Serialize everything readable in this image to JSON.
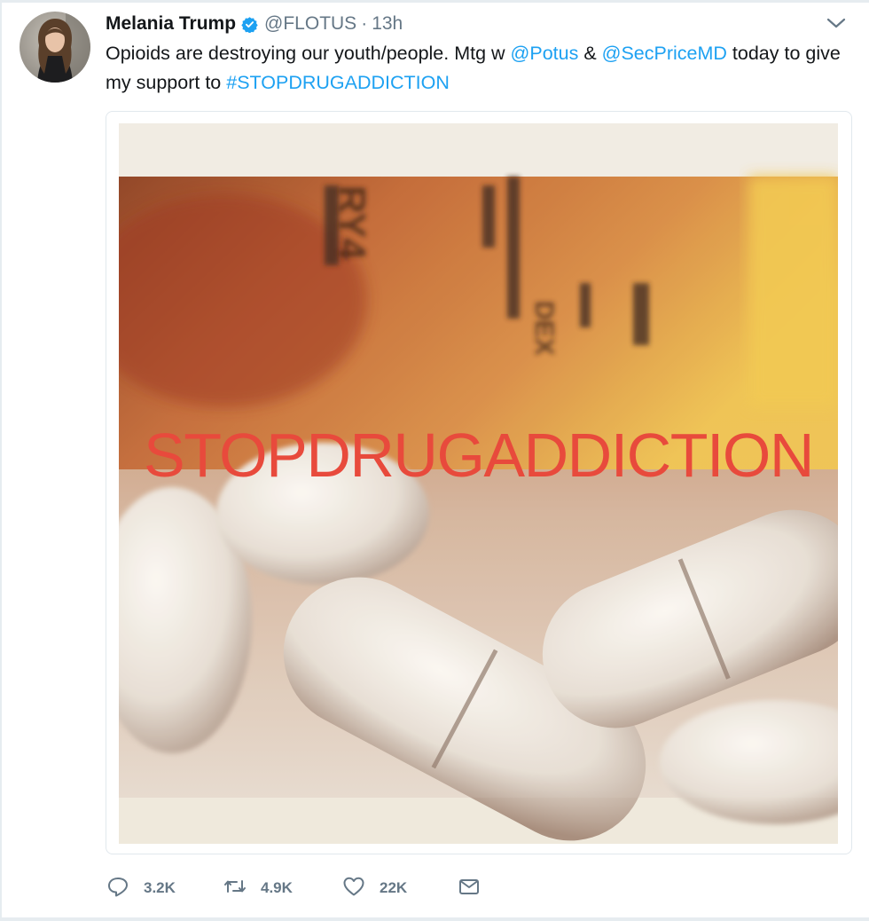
{
  "tweet": {
    "author_name": "Melania Trump",
    "handle": "@FLOTUS",
    "separator": "·",
    "timestamp": "13h",
    "text": {
      "part1": "Opioids are destroying our youth/people. Mtg w ",
      "mention1": "@Potus",
      "part2": " & ",
      "mention2": "@SecPriceMD",
      "part3": " today to give my support to ",
      "hashtag": "#STOPDRUGADDICTION"
    },
    "media": {
      "overlay_text": "STOPDRUGADDICTION",
      "bottle_label_fragments": [
        "RY4",
        "DEX"
      ]
    },
    "actions": {
      "replies": "3.2K",
      "retweets": "4.9K",
      "likes": "22K"
    }
  },
  "icons": {
    "verified": "verified-badge-icon",
    "caret": "chevron-down-icon",
    "reply": "reply-icon",
    "retweet": "retweet-icon",
    "like": "heart-icon",
    "dm": "envelope-icon"
  },
  "colors": {
    "link": "#1da1f2",
    "muted": "#657786",
    "text": "#14171a",
    "overlay_text": "#e84a3c"
  }
}
